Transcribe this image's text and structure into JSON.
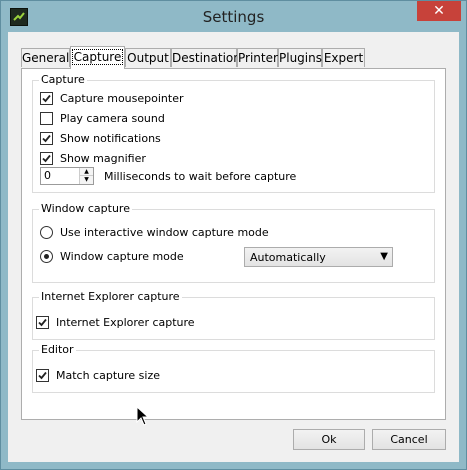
{
  "window": {
    "title": "Settings",
    "close_glyph": "✕",
    "icon": "app-icon"
  },
  "tabs": [
    {
      "label": "General",
      "active": false
    },
    {
      "label": "Capture",
      "active": true
    },
    {
      "label": "Output",
      "active": false
    },
    {
      "label": "Destination",
      "active": false
    },
    {
      "label": "Printer",
      "active": false
    },
    {
      "label": "Plugins",
      "active": false
    },
    {
      "label": "Expert",
      "active": false
    }
  ],
  "capture_group": {
    "title": "Capture",
    "options": [
      {
        "label": "Capture mousepointer",
        "checked": true
      },
      {
        "label": "Play camera sound",
        "checked": false
      },
      {
        "label": "Show notifications",
        "checked": true
      },
      {
        "label": "Show magnifier",
        "checked": true
      }
    ],
    "wait": {
      "value": "0",
      "label": "Milliseconds to wait before capture"
    }
  },
  "window_capture_group": {
    "title": "Window capture",
    "interactive_label": "Use interactive window capture mode",
    "mode_label": "Window capture mode",
    "mode_selected": "Automatically",
    "selected_radio": "mode"
  },
  "ie_group": {
    "title": "Internet Explorer capture",
    "option_label": "Internet Explorer capture",
    "checked": true
  },
  "editor_group": {
    "title": "Editor",
    "option_label": "Match capture size",
    "checked": true
  },
  "buttons": {
    "ok": "Ok",
    "cancel": "Cancel"
  },
  "colors": {
    "frame": "#8fb9c7",
    "close": "#c7423a"
  }
}
